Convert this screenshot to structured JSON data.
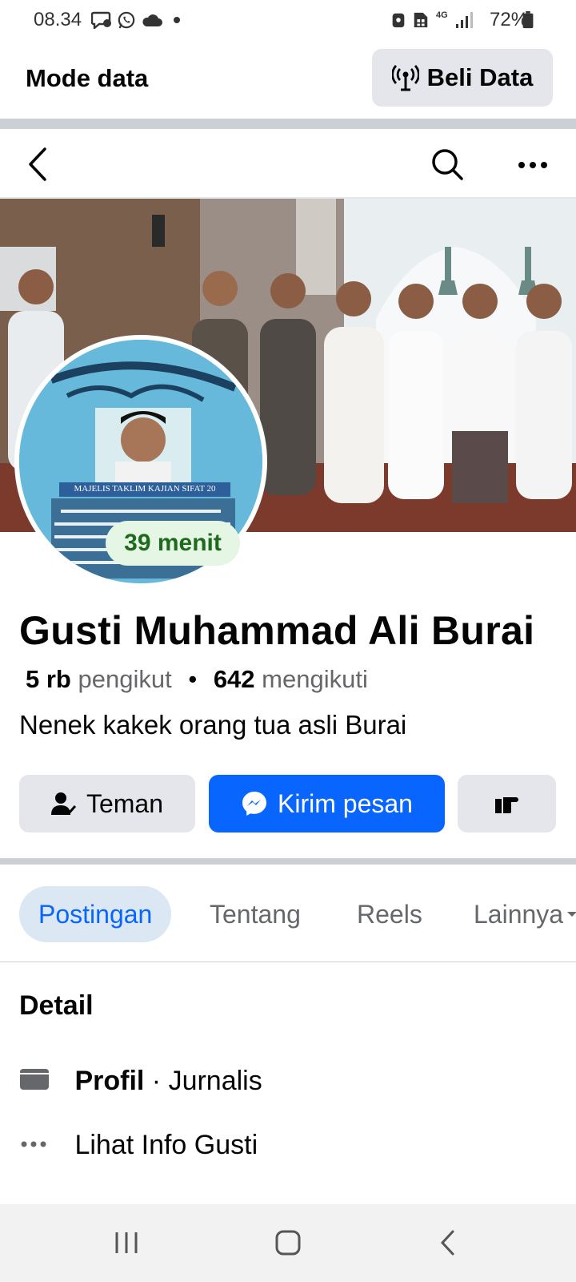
{
  "status_bar": {
    "time": "08.34",
    "battery": "72%",
    "network": "4G",
    "icons": [
      "chat-bubble-icon",
      "whatsapp-icon",
      "cloud-icon",
      "dot-icon",
      "lock-icon",
      "sim-icon",
      "signal-icon",
      "battery-icon"
    ]
  },
  "data_bar": {
    "mode_label": "Mode data",
    "buy_label": "Beli Data",
    "buy_icon": "antenna-icon"
  },
  "nav": {
    "back_icon": "back-chevron-icon",
    "search_icon": "search-icon",
    "more_icon": "more-dots-icon"
  },
  "avatar": {
    "banner_text": "MAJELIS TAKLIM KAJIAN SIFAT 20",
    "story_badge": "39 menit"
  },
  "profile": {
    "name": "Gusti Muhammad Ali Burai",
    "followers_count": "5 rb",
    "followers_label": "pengikut",
    "following_count": "642",
    "following_label": "mengikuti",
    "separator": "•",
    "bio": "Nenek kakek orang tua asli Burai"
  },
  "actions": {
    "friend_label": "Teman",
    "message_label": "Kirim pesan",
    "poke_icon": "poke-hand-icon"
  },
  "tabs": [
    {
      "label": "Postingan",
      "active": true
    },
    {
      "label": "Tentang",
      "active": false
    },
    {
      "label": "Reels",
      "active": false
    },
    {
      "label": "Lainnya",
      "active": false
    }
  ],
  "details": {
    "title": "Detail",
    "profile_label": "Profil",
    "profile_sep": " · ",
    "profile_value": "Jurnalis",
    "info_label": "Lihat Info Gusti"
  },
  "colors": {
    "accent": "#0866ff",
    "button_gray": "#e4e6eb",
    "tab_active_bg": "#dbe7f2",
    "story_badge_text": "#1e6b1e"
  }
}
